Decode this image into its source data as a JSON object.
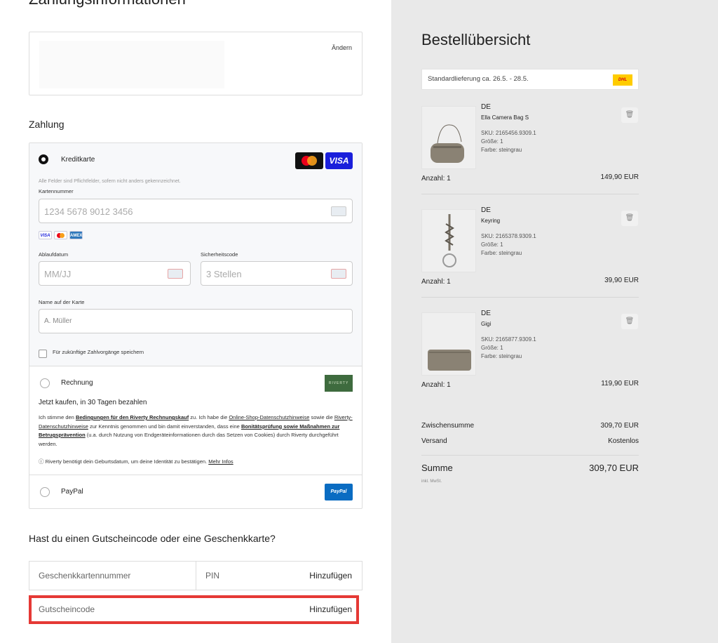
{
  "left": {
    "cut_title": "Zahlungsinformationen",
    "address": {
      "change_label": "Ändern"
    },
    "payment_title": "Zahlung",
    "credit_card": {
      "label": "Kreditkarte",
      "required_note": "Alle Felder sind Pflichtfelder, sofern nicht anders gekennzeichnet.",
      "card_number_label": "Kartennummer",
      "card_number_placeholder": "1234 5678 9012 3456",
      "expiry_label": "Ablaufdatum",
      "expiry_placeholder": "MM/JJ",
      "cvc_label": "Sicherheitscode",
      "cvc_placeholder": "3 Stellen",
      "name_label": "Name auf der Karte",
      "name_placeholder": "A. Müller",
      "save_label": "Für zukünftige Zahlvorgänge speichern",
      "logo_visa": "VISA",
      "mini_visa": "VISA",
      "mini_amex": "AMEX"
    },
    "invoice": {
      "label": "Rechnung",
      "logo": "RIVERTY",
      "headline": "Jetzt kaufen, in 30 Tagen bezahlen",
      "t1": "Ich stimme den ",
      "l1": "Bedingungen für den Riverty Rechnungskauf",
      "t2": " zu. Ich habe die ",
      "l2": "Online-Shop-Datenschutzhinweise",
      "t3": " sowie die ",
      "l3": "Riverty-Datenschutzhinweise",
      "t4": " zur Kenntnis genommen und bin damit einverstanden, dass eine ",
      "l4": "Bonitätsprüfung sowie Maßnahmen zur Betrugsprävention",
      "t5": " (u.a. durch Nutzung von Endgeräteinformationen durch das Setzen von Cookies) durch Riverty durchgeführt werden.",
      "info_text": "Riverty benötigt dein Geburtsdatum, um deine Identität zu bestätigen. ",
      "info_link": "Mehr Infos"
    },
    "paypal": {
      "label": "PayPal",
      "logo": "PayPal"
    },
    "voucher_title": "Hast du einen Gutscheincode oder eine Geschenkkarte?",
    "giftcard_placeholder": "Geschenkkartennummer",
    "pin_placeholder": "PIN",
    "add_label": "Hinzufügen",
    "coupon_placeholder": "Gutscheincode"
  },
  "summary": {
    "title": "Bestellübersicht",
    "shipping_text": "Standardlieferung ca. 26.5. - 28.5.",
    "dhl_logo": "DHL",
    "items": [
      {
        "brand": "DE",
        "name": "Ella Camera Bag S",
        "sku": "SKU: 2165456.9309.1",
        "size": "Größe: 1",
        "color": "Farbe: steingrau",
        "qty": "Anzahl: 1",
        "price": "149,90 EUR"
      },
      {
        "brand": "DE",
        "name": "Keyring",
        "sku": "SKU: 2165378.9309.1",
        "size": "Größe: 1",
        "color": "Farbe: steingrau",
        "qty": "Anzahl: 1",
        "price": "39,90 EUR"
      },
      {
        "brand": "DE",
        "name": "Gigi",
        "sku": "SKU: 2165877.9309.1",
        "size": "Größe: 1",
        "color": "Farbe: steingrau",
        "qty": "Anzahl: 1",
        "price": "119,90 EUR"
      }
    ],
    "subtotal_label": "Zwischensumme",
    "subtotal_value": "309,70 EUR",
    "shipping_label": "Versand",
    "shipping_value": "Kostenlos",
    "total_label": "Summe",
    "total_value": "309,70 EUR",
    "vat_note": "inkl. MwSt."
  }
}
